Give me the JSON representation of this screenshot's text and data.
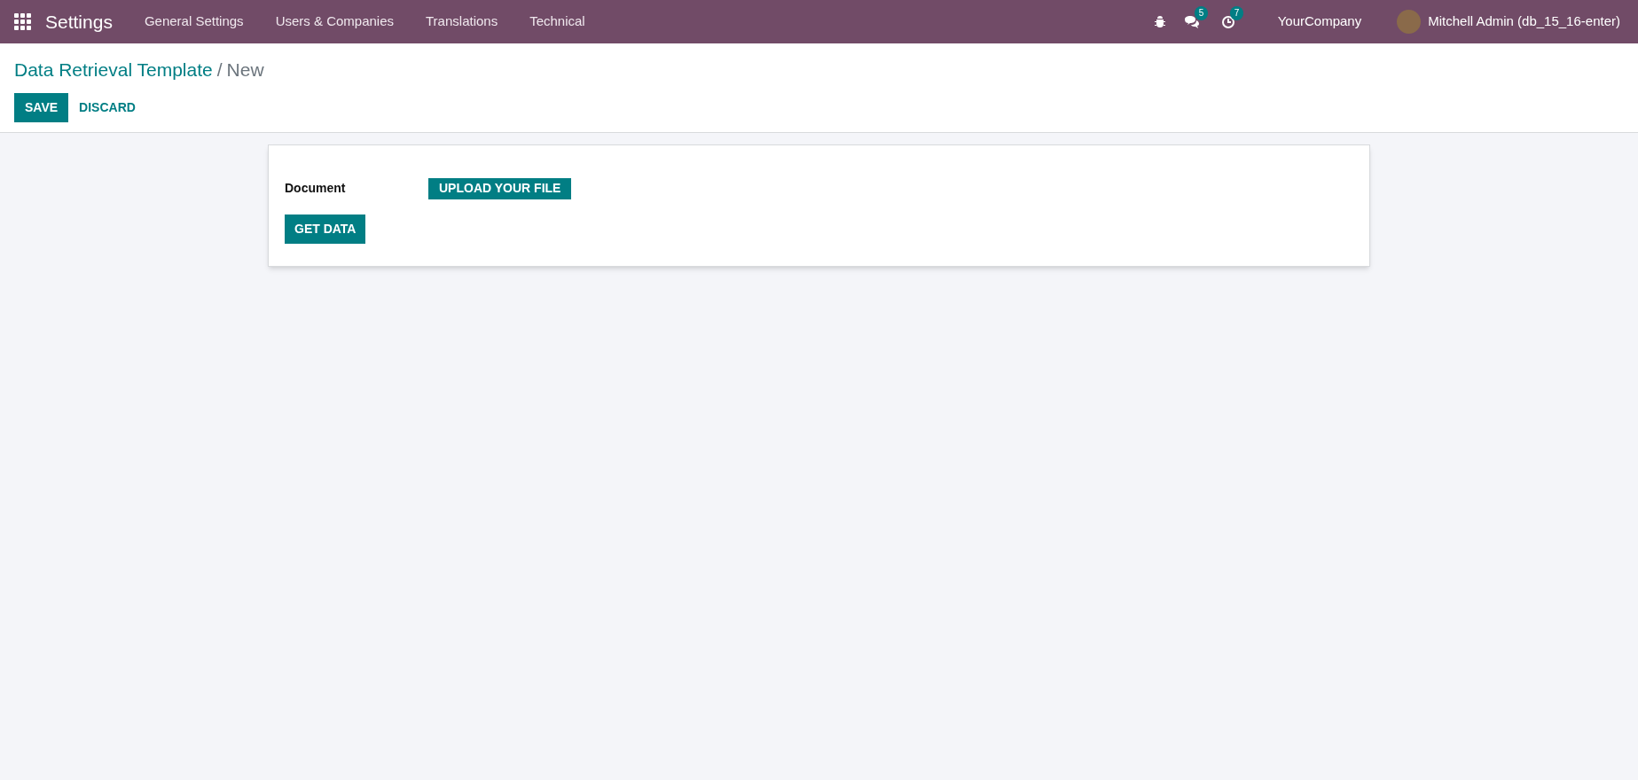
{
  "navbar": {
    "app_title": "Settings",
    "menu": [
      "General Settings",
      "Users & Companies",
      "Translations",
      "Technical"
    ],
    "messages_badge": "5",
    "activities_badge": "7",
    "company": "YourCompany",
    "user": "Mitchell Admin (db_15_16-enter)"
  },
  "breadcrumb": {
    "parent": "Data Retrieval Template",
    "separator": "/",
    "current": "New"
  },
  "actions": {
    "save": "SAVE",
    "discard": "DISCARD"
  },
  "form": {
    "field_label": "Document",
    "upload_button": "UPLOAD YOUR FILE",
    "get_data_button": "GET DATA"
  }
}
